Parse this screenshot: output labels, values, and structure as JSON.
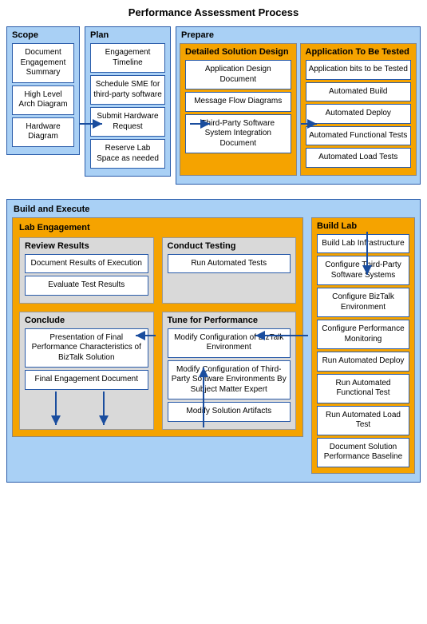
{
  "title": "Performance Assessment Process",
  "scope": {
    "label": "Scope",
    "items": [
      "Document Engagement Summary",
      "High Level Arch Diagram",
      "Hardware Diagram"
    ]
  },
  "plan": {
    "label": "Plan",
    "items": [
      "Engagement Timeline",
      "Schedule SME for third-party software",
      "Submit Hardware Request",
      "Reserve Lab Space as needed"
    ]
  },
  "prepare": {
    "label": "Prepare",
    "design": {
      "label": "Detailed Solution Design",
      "items": [
        "Application Design Document",
        "Message Flow Diagrams",
        "Third-Party Software System Integration Document"
      ]
    },
    "app": {
      "label": "Application To Be Tested",
      "items": [
        "Application bits to be Tested",
        "Automated Build",
        "Automated Deploy",
        "Automated Functional  Tests",
        "Automated Load Tests"
      ]
    }
  },
  "build_execute": {
    "label": "Build and Execute",
    "lab_engagement": {
      "label": "Lab Engagement",
      "review": {
        "label": "Review Results",
        "items": [
          "Document Results of Execution",
          "Evaluate Test Results"
        ]
      },
      "conduct": {
        "label": "Conduct Testing",
        "items": [
          "Run Automated Tests"
        ]
      },
      "conclude": {
        "label": "Conclude",
        "items": [
          "Presentation of Final Performance Characteristics of BizTalk Solution",
          "Final Engagement Document"
        ]
      },
      "tune": {
        "label": "Tune for Performance",
        "items": [
          "Modify Configuration of BizTalk Environment",
          "Modify Configuration of Third-Party Software Environments By Subject Matter Expert",
          "Modify Solution Artifacts"
        ]
      }
    },
    "build_lab": {
      "label": "Build Lab",
      "items": [
        "Build Lab Infrastructure",
        "Configure Third-Party Software Systems",
        "Configure BizTalk Environment",
        "Configure Performance Monitoring",
        "Run Automated Deploy",
        "Run Automated Functional Test",
        "Run Automated Load Test",
        "Document Solution Performance Baseline"
      ]
    }
  }
}
